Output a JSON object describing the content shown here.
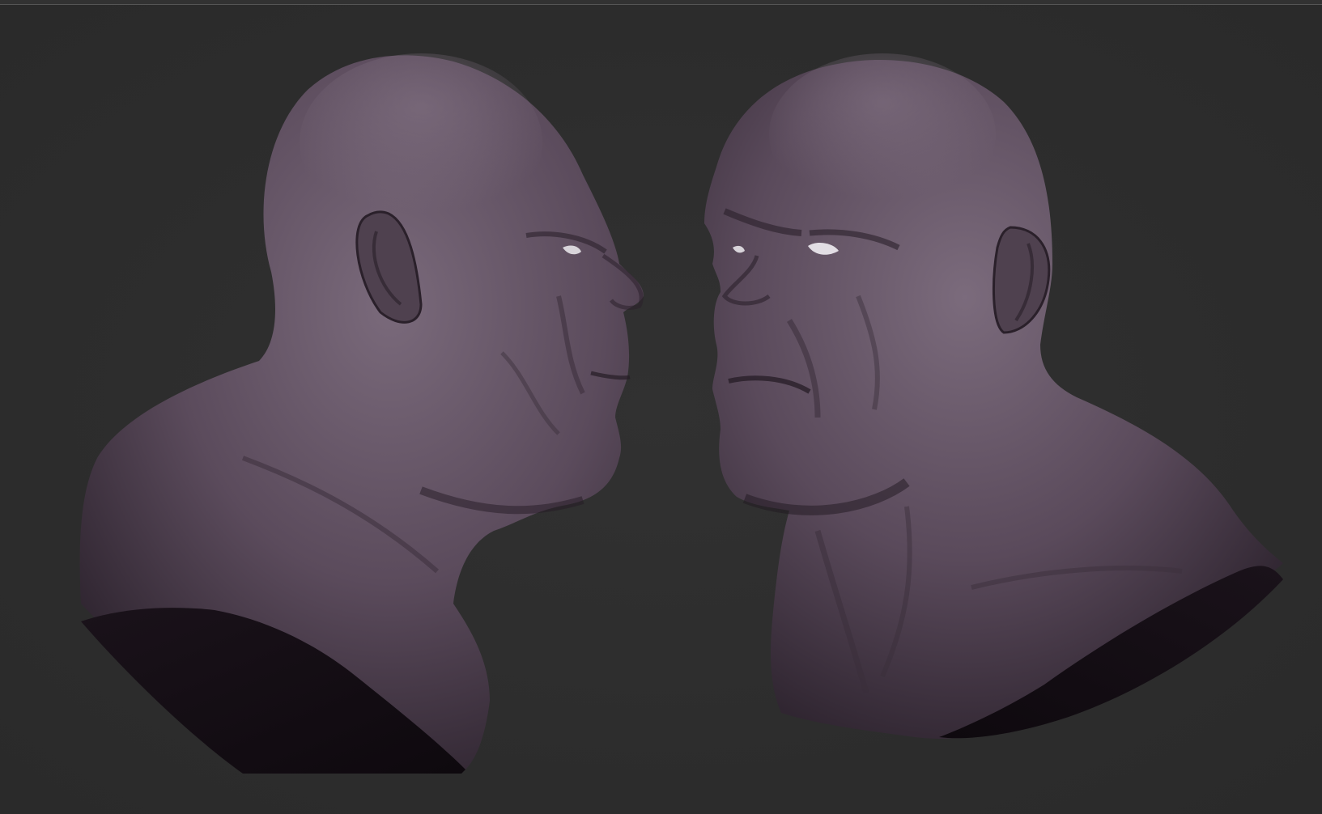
{
  "app": {
    "viewport_background": "#2d2d2d",
    "divider_color": "#565656"
  },
  "scene": {
    "models": [
      {
        "id": "bust-left",
        "view": "profile-right",
        "material_color": "#5a4c5b"
      },
      {
        "id": "bust-right",
        "view": "three-quarter-left",
        "material_color": "#5a4c5b"
      }
    ],
    "cap_color": "#140d14"
  }
}
